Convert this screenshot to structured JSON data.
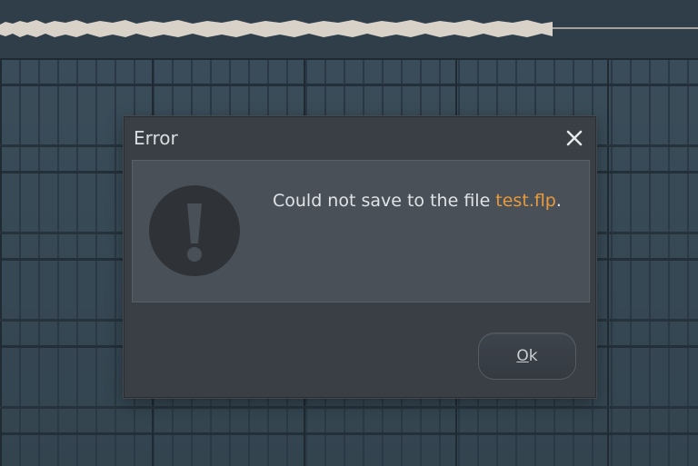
{
  "dialog": {
    "title": "Error",
    "close_icon": "close-icon",
    "message_prefix": "Could not save to the file ",
    "filename": "test.flp",
    "message_suffix": ".",
    "icon": "exclamation-icon",
    "ok_mnemonic": "O",
    "ok_rest": "k"
  },
  "colors": {
    "accent_filename": "#e89a3c",
    "dialog_bg": "#3a3f45",
    "content_bg": "#4a5058",
    "playlist_bg": "#3a4c58",
    "waveform": "#d9d2c8"
  }
}
